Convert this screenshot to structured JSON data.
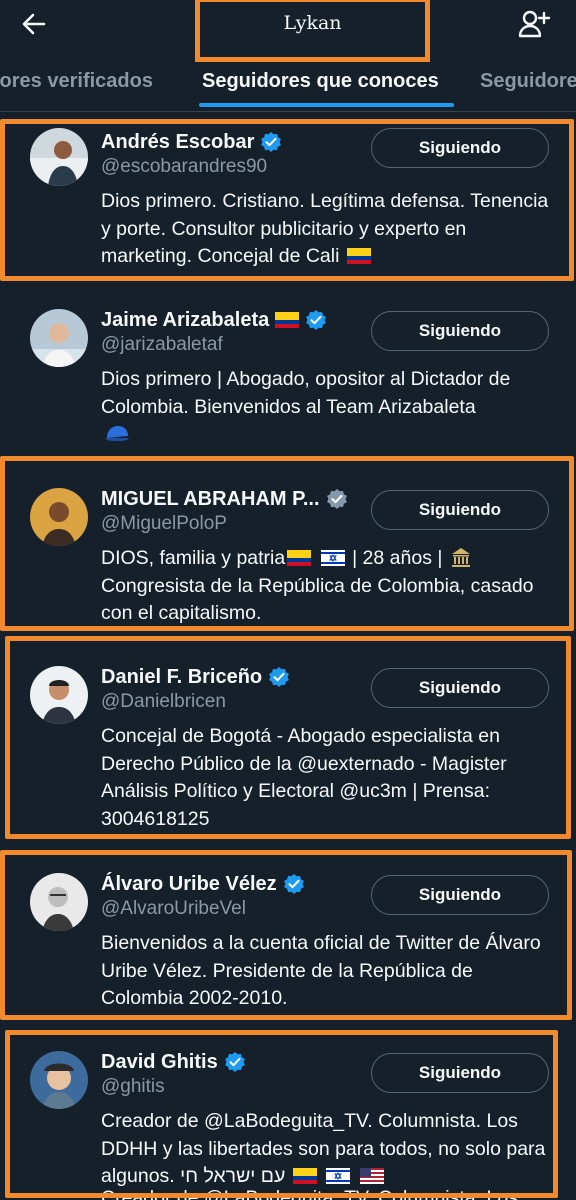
{
  "header": {
    "title": "Lykan",
    "back_icon": "arrow-left-icon",
    "add_icon": "add-user-icon"
  },
  "tabs": [
    {
      "label": "lores verificados"
    },
    {
      "label": "Seguidores que conoces",
      "active": true
    },
    {
      "label": "Seguidore"
    }
  ],
  "users": [
    {
      "name": "Andrés Escobar",
      "handle": "@escobarandres90",
      "verified": "blue",
      "button": "Siguiendo",
      "bio": "Dios primero. Cristiano. Legítima defensa. Tenencia y porte. Consultor publicitario y experto en marketing. Concejal de Cali"
    },
    {
      "name": "Jaime Arizabaleta",
      "handle": "@jarizabaletaf",
      "verified": "blue",
      "button": "Siguiendo",
      "bio": "Dios primero | Abogado, opositor al Dictador de Colombia. Bienvenidos al Team Arizabaleta"
    },
    {
      "name": "MIGUEL ABRAHAM P...",
      "handle": "@MiguelPoloP",
      "verified": "gray",
      "button": "Siguiendo",
      "bio_parts": [
        "DIOS, familia y patria",
        "| 28 años |",
        "Congresista de la República de Colombia, casado con el capitalismo."
      ]
    },
    {
      "name": "Daniel F. Briceño",
      "handle": "@Danielbricen",
      "verified": "blue",
      "button": "Siguiendo",
      "bio": "Concejal de Bogotá - Abogado especialista en Derecho Público de la @uexternado - Magister Análisis Político y Electoral @uc3m | Prensa: 3004618125"
    },
    {
      "name": "Álvaro Uribe Vélez",
      "handle": "@AlvaroUribeVel",
      "verified": "blue",
      "button": "Siguiendo",
      "bio": "Bienvenidos a la cuenta oficial de Twitter de Álvaro Uribe Vélez. Presidente de la República de Colombia 2002-2010."
    },
    {
      "name": "David Ghitis",
      "handle": "@ghitis",
      "verified": "blue",
      "button": "Siguiendo",
      "bio": "Creador de @LaBodeguita_TV. Columnista. Los DDHH y las libertades son para todos, no solo para algunos.",
      "bio_hebrew": "עם ישראל חי",
      "cut_line": "Creador de @LaBodeguita_TV. Columnista. Los"
    }
  ],
  "colors": {
    "background": "#15202b",
    "accent": "#1d9bf0",
    "highlight": "#f08a2c",
    "muted": "#8b98a5"
  }
}
